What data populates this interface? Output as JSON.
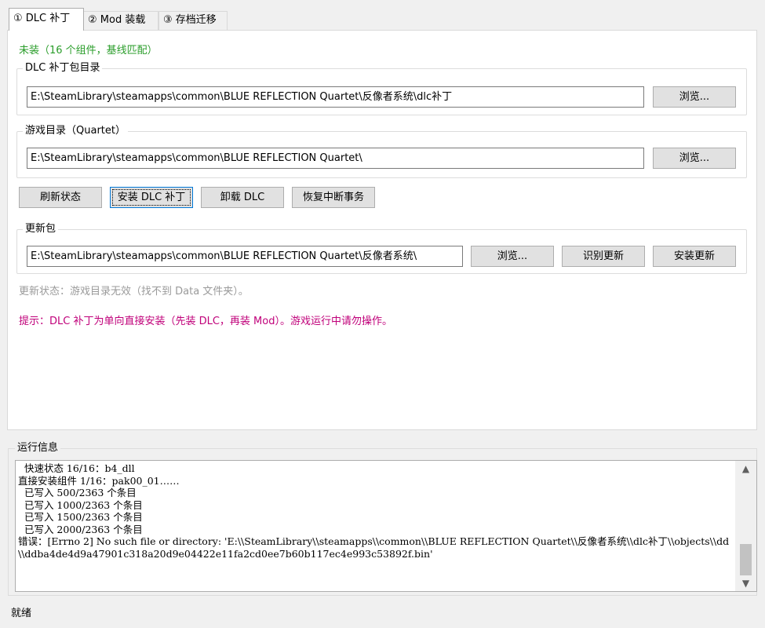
{
  "tabs": [
    {
      "label": "① DLC 补丁",
      "active": true
    },
    {
      "label": "② Mod 装载",
      "active": false
    },
    {
      "label": "③ 存档迁移",
      "active": false
    }
  ],
  "dlc": {
    "install_status": "未装（16 个组件，基线匹配）",
    "dlc_dir": {
      "label": "DLC 补丁包目录",
      "value": "E:\\SteamLibrary\\steamapps\\common\\BLUE REFLECTION Quartet\\反像者系统\\dlc补丁",
      "browse_label": "浏览..."
    },
    "game_dir": {
      "label": "游戏目录（Quartet）",
      "value": "E:\\SteamLibrary\\steamapps\\common\\BLUE REFLECTION Quartet\\",
      "browse_label": "浏览..."
    },
    "actions": {
      "refresh": "刷新状态",
      "install": "安装 DLC 补丁",
      "uninstall": "卸载 DLC",
      "recover": "恢复中断事务"
    },
    "update": {
      "label": "更新包",
      "value": "E:\\SteamLibrary\\steamapps\\common\\BLUE REFLECTION Quartet\\反像者系统\\",
      "browse_label": "浏览...",
      "detect_label": "识别更新",
      "install_label": "安装更新",
      "status": "更新状态：游戏目录无效（找不到 Data 文件夹）。"
    },
    "hint": "提示：DLC 补丁为单向直接安装（先装 DLC，再装 Mod）。游戏运行中请勿操作。"
  },
  "log": {
    "label": "运行信息",
    "text": "  快速状态 16/16：b4_dll\n直接安装组件 1/16：pak00_01……\n  已写入 500/2363 个条目\n  已写入 1000/2363 个条目\n  已写入 1500/2363 个条目\n  已写入 2000/2363 个条目\n错误：[Errno 2] No such file or directory: 'E:\\\\SteamLibrary\\\\steamapps\\\\common\\\\BLUE REFLECTION Quartet\\\\反像者系统\\\\dlc补丁\\\\objects\\\\dd\\\\ddba4de4d9a47901c318a20d9e04422e11fa2cd0ee7b60b117ec4e993c53892f.bin'",
    "scroll_up": "▲",
    "scroll_down": "▼"
  },
  "statusbar": {
    "text": "就绪"
  }
}
